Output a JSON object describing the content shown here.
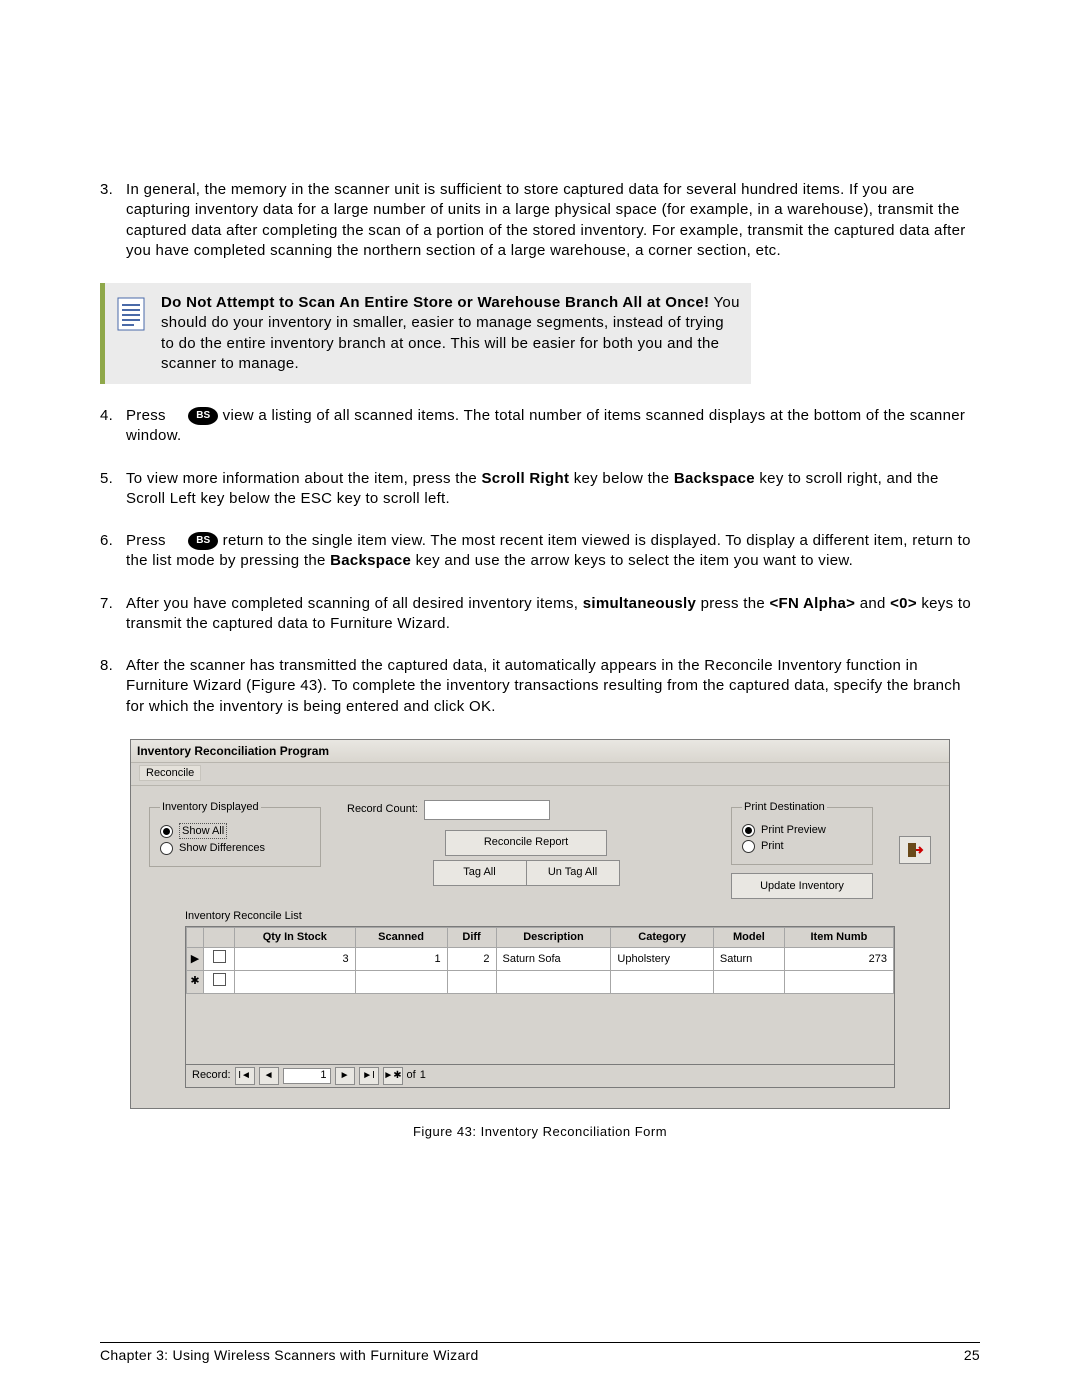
{
  "steps": {
    "s3_num": "3.",
    "s3": "In general, the memory in the scanner unit is sufficient to store captured data for several hundred items. If you are capturing inventory data for a large number of units in a large physical space (for example, in a warehouse), transmit the captured data after completing the scan of a portion of the stored inventory. For example, transmit the captured data after you have completed scanning the northern section of a large warehouse, a corner section, etc.",
    "note_lead": "Do Not Attempt to Scan An Entire Store or Warehouse Branch All at Once!",
    "note_rest": " You should do your inventory in smaller, easier to manage segments, instead of trying to do the entire inventory branch at once. This will be easier for both you and the scanner to manage.",
    "s4_num": "4.",
    "s4_a": "Press ",
    "s4_key": "BS",
    "s4_b": " view a listing of all scanned items. The total number of items scanned displays at the bottom of the scanner window.",
    "s5_num": "5.",
    "s5_a": "To view more information about the item, press the ",
    "s5_b": "Scroll Right",
    "s5_c": " key below the ",
    "s5_d": "Backspace",
    "s5_e": " key to scroll right, and the Scroll Left key below the ESC key to scroll left.",
    "s6_num": "6.",
    "s6_a": "Press ",
    "s6_key": "BS",
    "s6_b": " return to the single item view. The most recent item viewed is displayed. To display a different item, return to the list mode by pressing the ",
    "s6_c": "Backspace",
    "s6_d": " key and use the arrow keys to select the item you want to view.",
    "s7_num": "7.",
    "s7_a": "After you have completed scanning of all desired inventory items, ",
    "s7_b": "simultaneously",
    "s7_c": " press the ",
    "s7_d": "<FN Alpha>",
    "s7_e": " and ",
    "s7_f": "<0>",
    "s7_g": " keys to transmit the captured data to Furniture Wizard.",
    "s8_num": "8.",
    "s8": "After the scanner has transmitted the captured data, it automatically appears in the Reconcile Inventory function in Furniture Wizard (Figure 43). To complete the inventory transactions resulting from the captured data, specify the branch for which the inventory is being entered and click OK."
  },
  "figure": {
    "title": "Inventory Reconciliation Program",
    "menu_reconcile": "Reconcile",
    "grp_inv_disp": "Inventory Displayed",
    "opt_show_all": "Show All",
    "opt_show_diff": "Show Differences",
    "record_count_label": "Record Count:",
    "btn_reconcile_report": "Reconcile Report",
    "btn_tag_all": "Tag All",
    "btn_untag_all": "Un Tag All",
    "grp_print_dest": "Print Destination",
    "opt_print_preview": "Print Preview",
    "opt_print": "Print",
    "btn_update_inventory": "Update Inventory",
    "list_label": "Inventory Reconcile List",
    "headers": {
      "qty": "Qty In Stock",
      "scanned": "Scanned",
      "diff": "Diff",
      "desc": "Description",
      "cat": "Category",
      "model": "Model",
      "itemnum": "Item Numb"
    },
    "row": {
      "qty": "3",
      "scanned": "1",
      "diff": "2",
      "desc": "Saturn Sofa",
      "cat": "Upholstery",
      "model": "Saturn",
      "itemnum": "273"
    },
    "recnav": {
      "label": "Record:",
      "current": "1",
      "of": "of",
      "total": "1"
    },
    "caption": "Figure 43: Inventory Reconciliation Form"
  },
  "footer": {
    "left": "Chapter 3: Using Wireless Scanners with Furniture Wizard",
    "right": "25"
  }
}
